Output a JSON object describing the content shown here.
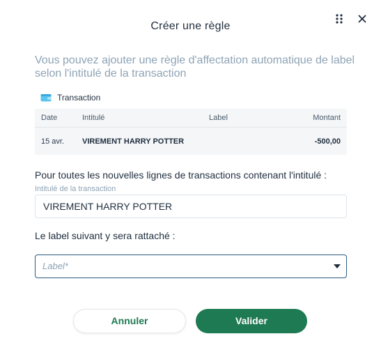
{
  "dialog": {
    "title": "Créer une règle",
    "intro": "Vous pouvez ajouter une règle d'affectation automatique de label selon l'intitulé de la transaction"
  },
  "icons": {
    "drag": "drag-handle-icon",
    "close": "close-icon",
    "wallet": "wallet-icon",
    "caret": "caret-down-icon"
  },
  "transaction": {
    "section_label": "Transaction",
    "headers": {
      "date": "Date",
      "intitule": "Intitulé",
      "label": "Label",
      "montant": "Montant"
    },
    "row": {
      "date": "15 avr.",
      "intitule": "VIREMENT HARRY POTTER",
      "label": "",
      "montant": "-500,00"
    }
  },
  "rule": {
    "prompt": "Pour toutes les nouvelles lignes de transactions contenant l'intitulé :",
    "field_label": "Intitulé de la transaction",
    "field_value": "VIREMENT HARRY POTTER",
    "label_prompt": "Le label suivant y sera rattaché :",
    "label_placeholder": "Label*"
  },
  "buttons": {
    "cancel": "Annuler",
    "submit": "Valider"
  },
  "colors": {
    "accent": "#1e7a52",
    "muted_text": "#8ea3b5",
    "select_border": "#2a5a83"
  }
}
